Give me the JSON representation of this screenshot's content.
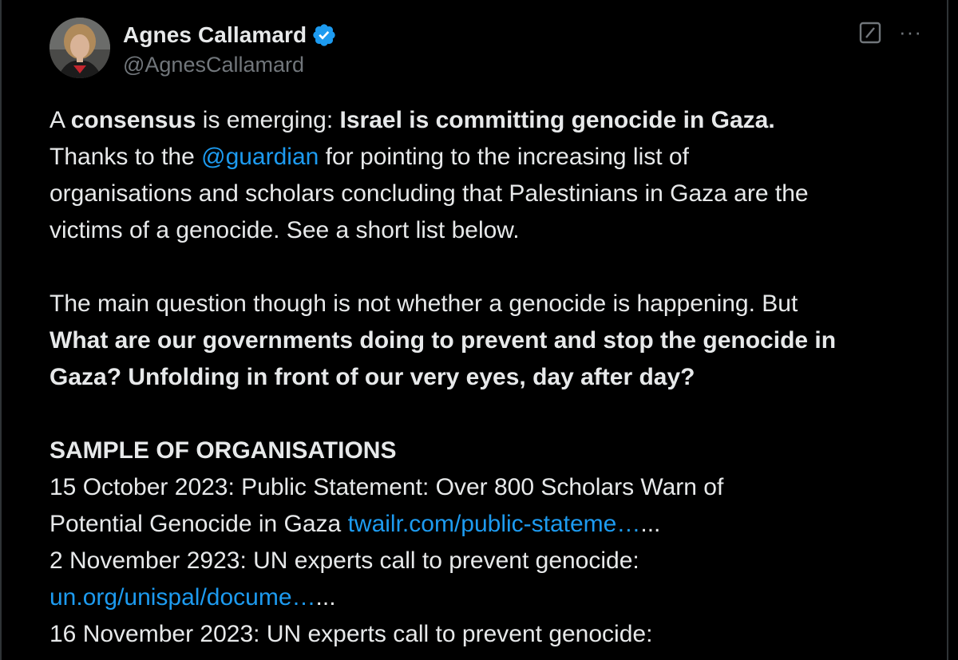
{
  "author": {
    "name": "Agnes Callamard",
    "handle": "@AgnesCallamard",
    "verified_color": "#1d9bf0",
    "avatar_icon": "avatar-photo"
  },
  "header_actions": {
    "grok_icon": "grok-icon",
    "more_label": "···"
  },
  "tweet": {
    "p1": {
      "t1": "A ",
      "t2": "consensus",
      "t3": " is emerging: ",
      "t4": "Israel is committing genocide in Gaza.",
      "t5": "Thanks to the ",
      "mention": "@guardian",
      "t6": " for pointing to the increasing list of",
      "t7": "organisations and scholars concluding that Palestinians in Gaza are the",
      "t8": "victims of a genocide.  See a short list below."
    },
    "p2": {
      "t1": "The main question though is not whether a genocide is happening. But",
      "t2": "What are our governments doing to prevent and stop the genocide in",
      "t3": "Gaza? Unfolding in front of our very eyes, day after day?"
    },
    "p3": {
      "heading": "SAMPLE OF ORGANISATIONS",
      "l1": "15 October 2023: Public Statement: Over 800 Scholars Warn of",
      "l2a": "Potential Genocide in Gaza ",
      "l2link": "twailr.com/public-stateme…",
      "l2b": "...",
      "l3": "2 November 2923: UN experts call to prevent genocide:",
      "l4link": "un.org/unispal/docume…",
      "l4b": "...",
      "l5": "16 November 2023: UN experts call to prevent genocide:"
    }
  },
  "colors": {
    "background": "#000000",
    "text": "#e7e9ea",
    "secondary": "#71767b",
    "link": "#1d9bf0"
  }
}
